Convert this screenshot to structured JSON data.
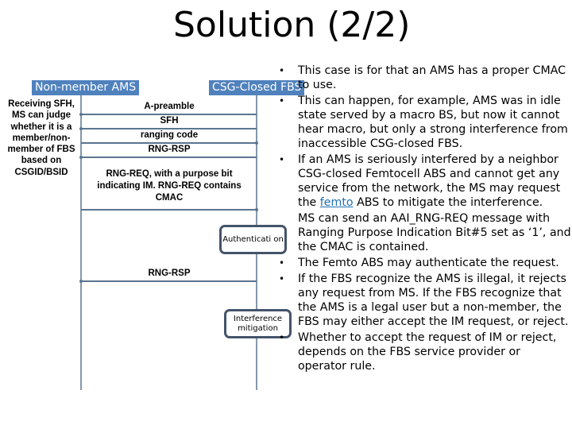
{
  "slide": {
    "title": "Solution (2/2)"
  },
  "diagram": {
    "left_actor": "Non-member AMS",
    "right_actor": "CSG-Closed FBS",
    "side_note": "Receiving SFH, MS can judge whether it is a member/non-member of FBS based on CSGID/BSID",
    "messages": [
      {
        "label": "A-preamble",
        "direction": "right-to-left"
      },
      {
        "label": "SFH",
        "direction": "right-to-left"
      },
      {
        "label": "ranging code",
        "direction": "left-to-right"
      },
      {
        "label": "RNG-RSP",
        "direction": "right-to-left"
      },
      {
        "label": "RNG-REQ, with a purpose bit indicating IM. RNG-REQ contains CMAC",
        "direction": "left-to-right"
      },
      {
        "label": "RNG-RSP",
        "direction": "right-to-left"
      }
    ],
    "processes": [
      {
        "label": "Authenticati on"
      },
      {
        "label": "Interference mitigation"
      }
    ],
    "colors": {
      "header_bg": "#4f81bd",
      "lifeline": "#5a7590",
      "box_border": "#44546a"
    }
  },
  "bullets": [
    {
      "text": "This case is for that an AMS has a proper CMAC to use."
    },
    {
      "text": "This can happen, for example, AMS was in idle state served by a macro BS, but now it cannot hear macro, but only a strong interference from inaccessible CSG-closed FBS."
    },
    {
      "text_before": "If an AMS  is seriously interfered by a neighbor CSG-closed Femtocell ABS and cannot get any service from the network, the MS may request the ",
      "link": "femto",
      "text_after": " ABS to mitigate the interference."
    },
    {
      "text": "MS can send an AAI_RNG-REQ message with Ranging Purpose Indication Bit#5 set as ‘1’, and the CMAC is contained."
    },
    {
      "text": "The Femto ABS may authenticate the request."
    },
    {
      "text": "If the FBS recognize the AMS is illegal, it rejects any request from MS. If the FBS recognize that the AMS is a legal user but a non-member, the FBS may either accept the IM request, or reject."
    },
    {
      "text": "Whether to accept the request of IM or reject, depends on the FBS service provider or operator rule."
    }
  ],
  "bullet_glyph": "•"
}
